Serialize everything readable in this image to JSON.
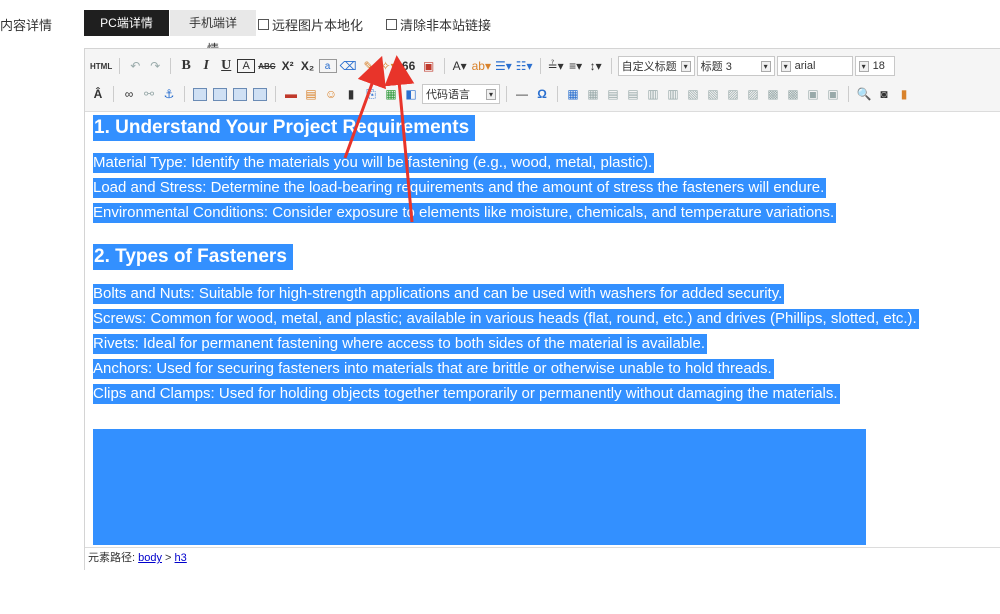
{
  "field": {
    "label": "内容详情"
  },
  "tabs": [
    {
      "label": "PC端详情",
      "active": true
    },
    {
      "label": "手机端详情",
      "active": false
    }
  ],
  "options": [
    {
      "label": "远程图片本地化",
      "checked": false
    },
    {
      "label": "清除非本站链接",
      "checked": false
    }
  ],
  "toolbar": {
    "html_label": "HTML",
    "bold": "B",
    "italic": "I",
    "underline": "U",
    "superscript": "X²",
    "subscript": "X₂",
    "font_label": "A",
    "quote": "66",
    "custom_heading": "自定义标题",
    "heading": "标题 3",
    "font_family": "arial",
    "font_size": "18",
    "code_lang": "代码语言",
    "hr": "—",
    "omega": "Ω"
  },
  "content": {
    "h1": "1. Understand Your Project Requirements",
    "p1": [
      "Material Type: Identify the materials you will be fastening (e.g., wood, metal, plastic).",
      "Load and Stress: Determine the load-bearing requirements and the amount of stress the fasteners will endure.",
      "Environmental Conditions: Consider exposure to elements like moisture, chemicals, and temperature variations."
    ],
    "h2": "2. Types of Fasteners",
    "p2": [
      "Bolts and Nuts: Suitable for high-strength applications and can be used with washers for added security.",
      "Screws: Common for wood, metal, and plastic; available in various heads (flat, round, etc.) and drives (Phillips, slotted, etc.).",
      "Rivets: Ideal for permanent fastening where access to both sides of the material is available.",
      "Anchors: Used for securing fasteners into materials that are brittle or otherwise unable to hold threads.",
      "Clips and Clamps: Used for holding objects together temporarily or permanently without damaging the materials."
    ]
  },
  "status": {
    "prefix": "元素路径:",
    "body": "body",
    "sep": ">",
    "h3": "h3"
  },
  "colors": {
    "selection": "#3390ff",
    "arrow": "#e8342a",
    "active_tab": "#1f1f1f"
  }
}
